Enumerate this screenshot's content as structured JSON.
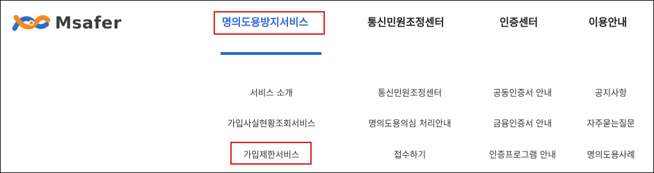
{
  "brand": {
    "name": "Msafer"
  },
  "nav": {
    "items": [
      {
        "label": "명의도용방지서비스"
      },
      {
        "label": "통신민원조정센터"
      },
      {
        "label": "인증센터"
      },
      {
        "label": "이용안내"
      }
    ]
  },
  "submenu": {
    "col1": [
      "서비스 소개",
      "가입사실현황조회서비스",
      "가입제한서비스"
    ],
    "col2": [
      "통신민원조정센터",
      "명의도용의심 처리안내",
      "접수하기"
    ],
    "col3": [
      "공동인증서 안내",
      "금융인증서 안내",
      "인증프로그램 안내"
    ],
    "col4": [
      "공지사항",
      "자주묻는질문",
      "명의도용사례"
    ]
  },
  "colors": {
    "accent": "#2a67d8",
    "highlight_box": "#e02020",
    "logo_orange": "#f28a1e",
    "logo_blue": "#2b6fce"
  },
  "icons": {
    "logo": "msafer-logo-mark"
  }
}
